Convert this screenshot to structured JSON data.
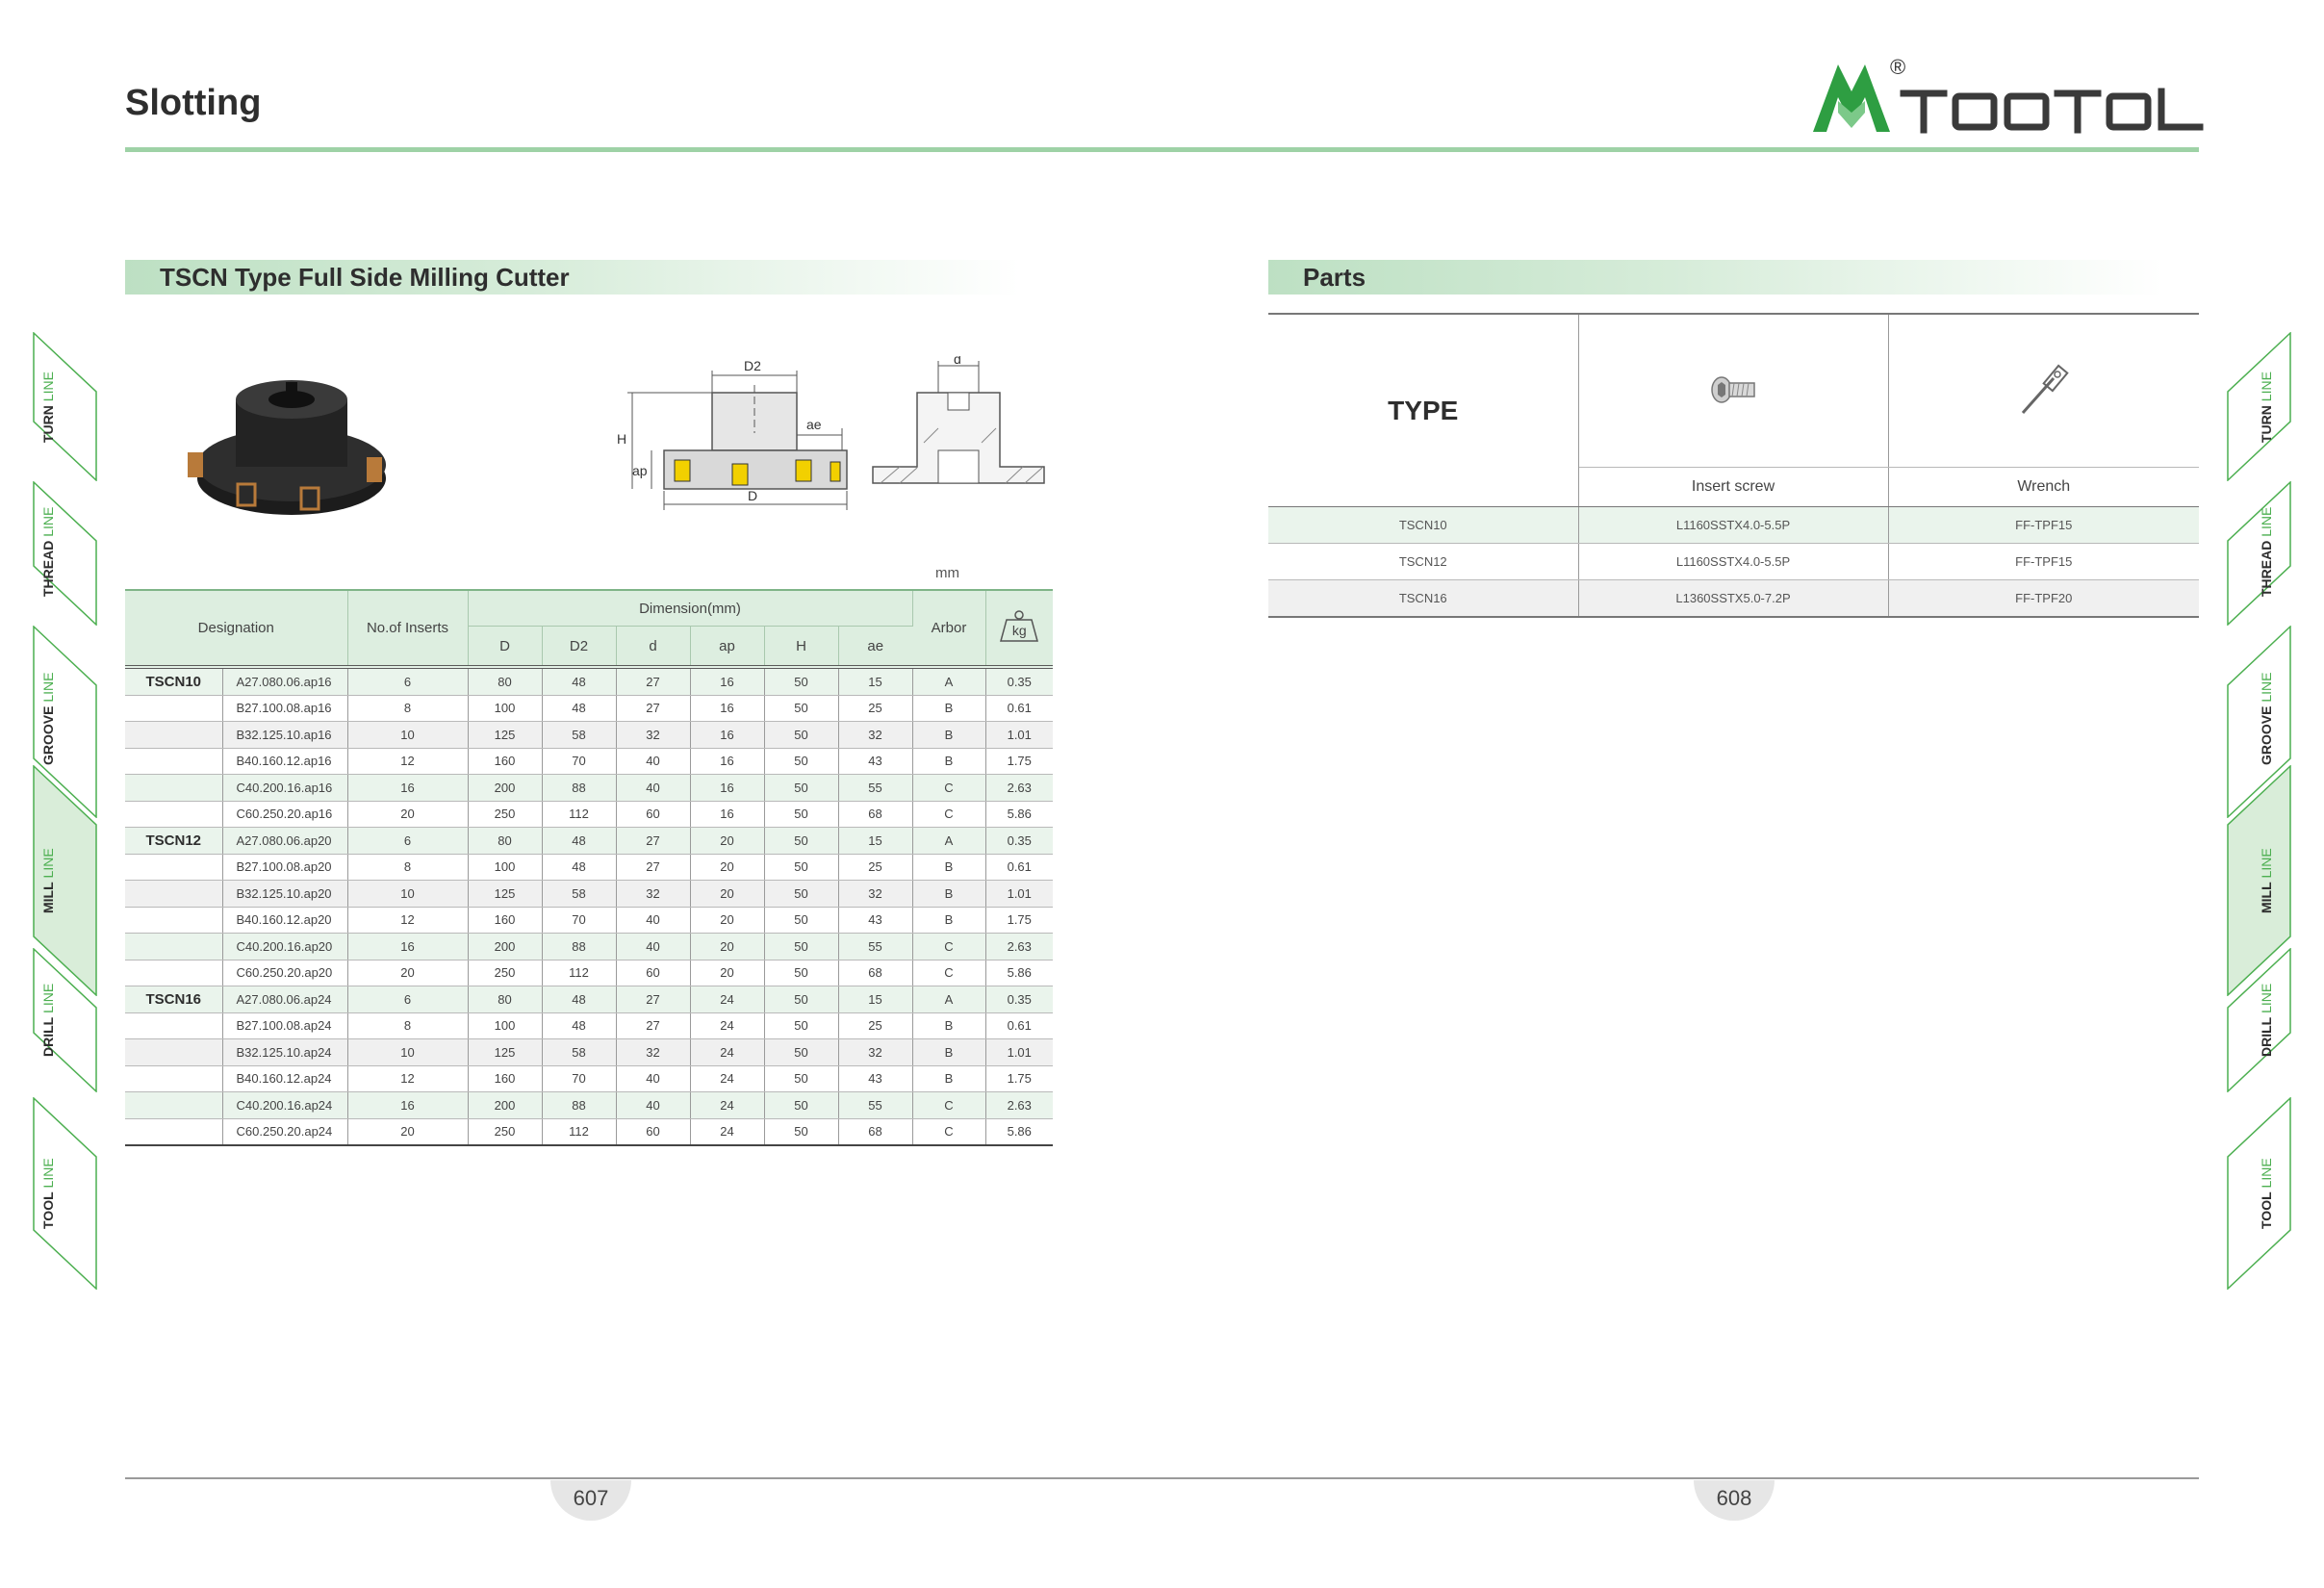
{
  "header": {
    "title": "Slotting",
    "brand": "TOOTOOL",
    "registered_mark": "®",
    "brand_color": "#2e9e42"
  },
  "sections": {
    "left_title": "TSCN Type Full Side Milling Cutter",
    "right_title": "Parts"
  },
  "drawing_labels": {
    "D2": "D2",
    "H": "H",
    "ap": "ap",
    "ae": "ae",
    "D": "D",
    "d": "d"
  },
  "unit": "mm",
  "main_table": {
    "headers": {
      "designation": "Designation",
      "inserts": "No.of Inserts",
      "dimension": "Dimension(mm)",
      "arbor": "Arbor",
      "weight_icon": "kg",
      "dims": [
        "D",
        "D2",
        "d",
        "ap",
        "H",
        "ae"
      ]
    },
    "rows": [
      {
        "group": "TSCN10",
        "des": "A27.080.06.ap16",
        "n": "6",
        "D": "80",
        "D2": "48",
        "d": "27",
        "ap": "16",
        "H": "50",
        "ae": "15",
        "arbor": "A",
        "kg": "0.35"
      },
      {
        "group": "",
        "des": "B27.100.08.ap16",
        "n": "8",
        "D": "100",
        "D2": "48",
        "d": "27",
        "ap": "16",
        "H": "50",
        "ae": "25",
        "arbor": "B",
        "kg": "0.61"
      },
      {
        "group": "",
        "des": "B32.125.10.ap16",
        "n": "10",
        "D": "125",
        "D2": "58",
        "d": "32",
        "ap": "16",
        "H": "50",
        "ae": "32",
        "arbor": "B",
        "kg": "1.01"
      },
      {
        "group": "",
        "des": "B40.160.12.ap16",
        "n": "12",
        "D": "160",
        "D2": "70",
        "d": "40",
        "ap": "16",
        "H": "50",
        "ae": "43",
        "arbor": "B",
        "kg": "1.75"
      },
      {
        "group": "",
        "des": "C40.200.16.ap16",
        "n": "16",
        "D": "200",
        "D2": "88",
        "d": "40",
        "ap": "16",
        "H": "50",
        "ae": "55",
        "arbor": "C",
        "kg": "2.63"
      },
      {
        "group": "",
        "des": "C60.250.20.ap16",
        "n": "20",
        "D": "250",
        "D2": "112",
        "d": "60",
        "ap": "16",
        "H": "50",
        "ae": "68",
        "arbor": "C",
        "kg": "5.86"
      },
      {
        "group": "TSCN12",
        "des": "A27.080.06.ap20",
        "n": "6",
        "D": "80",
        "D2": "48",
        "d": "27",
        "ap": "20",
        "H": "50",
        "ae": "15",
        "arbor": "A",
        "kg": "0.35"
      },
      {
        "group": "",
        "des": "B27.100.08.ap20",
        "n": "8",
        "D": "100",
        "D2": "48",
        "d": "27",
        "ap": "20",
        "H": "50",
        "ae": "25",
        "arbor": "B",
        "kg": "0.61"
      },
      {
        "group": "",
        "des": "B32.125.10.ap20",
        "n": "10",
        "D": "125",
        "D2": "58",
        "d": "32",
        "ap": "20",
        "H": "50",
        "ae": "32",
        "arbor": "B",
        "kg": "1.01"
      },
      {
        "group": "",
        "des": "B40.160.12.ap20",
        "n": "12",
        "D": "160",
        "D2": "70",
        "d": "40",
        "ap": "20",
        "H": "50",
        "ae": "43",
        "arbor": "B",
        "kg": "1.75"
      },
      {
        "group": "",
        "des": "C40.200.16.ap20",
        "n": "16",
        "D": "200",
        "D2": "88",
        "d": "40",
        "ap": "20",
        "H": "50",
        "ae": "55",
        "arbor": "C",
        "kg": "2.63"
      },
      {
        "group": "",
        "des": "C60.250.20.ap20",
        "n": "20",
        "D": "250",
        "D2": "112",
        "d": "60",
        "ap": "20",
        "H": "50",
        "ae": "68",
        "arbor": "C",
        "kg": "5.86"
      },
      {
        "group": "TSCN16",
        "des": "A27.080.06.ap24",
        "n": "6",
        "D": "80",
        "D2": "48",
        "d": "27",
        "ap": "24",
        "H": "50",
        "ae": "15",
        "arbor": "A",
        "kg": "0.35"
      },
      {
        "group": "",
        "des": "B27.100.08.ap24",
        "n": "8",
        "D": "100",
        "D2": "48",
        "d": "27",
        "ap": "24",
        "H": "50",
        "ae": "25",
        "arbor": "B",
        "kg": "0.61"
      },
      {
        "group": "",
        "des": "B32.125.10.ap24",
        "n": "10",
        "D": "125",
        "D2": "58",
        "d": "32",
        "ap": "24",
        "H": "50",
        "ae": "32",
        "arbor": "B",
        "kg": "1.01"
      },
      {
        "group": "",
        "des": "B40.160.12.ap24",
        "n": "12",
        "D": "160",
        "D2": "70",
        "d": "40",
        "ap": "24",
        "H": "50",
        "ae": "43",
        "arbor": "B",
        "kg": "1.75"
      },
      {
        "group": "",
        "des": "C40.200.16.ap24",
        "n": "16",
        "D": "200",
        "D2": "88",
        "d": "40",
        "ap": "24",
        "H": "50",
        "ae": "55",
        "arbor": "C",
        "kg": "2.63"
      },
      {
        "group": "",
        "des": "C60.250.20.ap24",
        "n": "20",
        "D": "250",
        "D2": "112",
        "d": "60",
        "ap": "24",
        "H": "50",
        "ae": "68",
        "arbor": "C",
        "kg": "5.86"
      }
    ]
  },
  "parts_table": {
    "type_label": "TYPE",
    "col1_label": "Insert screw",
    "col2_label": "Wrench",
    "col1_icon": "screw-icon",
    "col2_icon": "wrench-icon",
    "rows": [
      {
        "type": "TSCN10",
        "screw": "L1160SSTX4.0-5.5P",
        "wrench": "FF-TPF15"
      },
      {
        "type": "TSCN12",
        "screw": "L1160SSTX4.0-5.5P",
        "wrench": "FF-TPF15"
      },
      {
        "type": "TSCN16",
        "screw": "L1360SSTX5.0-7.2P",
        "wrench": "FF-TPF20"
      }
    ]
  },
  "side_tabs": [
    {
      "word": "TURN",
      "suffix": "LINE",
      "active": false
    },
    {
      "word": "THREAD",
      "suffix": "LINE",
      "active": false
    },
    {
      "word": "GROOVE",
      "suffix": "LINE",
      "active": false
    },
    {
      "word": "MILL",
      "suffix": "LINE",
      "active": true
    },
    {
      "word": "DRILL",
      "suffix": "LINE",
      "active": false
    },
    {
      "word": "TOOL",
      "suffix": "LINE",
      "active": false
    }
  ],
  "footer": {
    "page_left": "607",
    "page_right": "608"
  }
}
